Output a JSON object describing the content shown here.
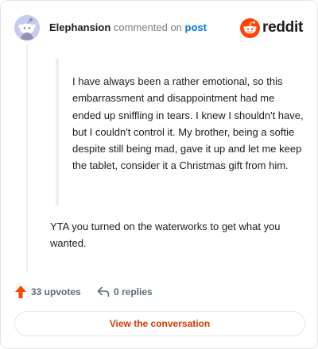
{
  "header": {
    "username": "Elephansion",
    "action_text": "commented on",
    "post_link": "post",
    "brand": "reddit"
  },
  "comment": {
    "quote": "I have always been a rather emotional, so this embarrassment and disappointment had me ended up sniffling in tears. I knew I shouldn't have, but I couldn't control it. My brother, being a softie despite still being mad, gave it up and let me keep the tablet, consider it a Christmas gift from him.",
    "reply": "YTA you turned on the waterworks to get what you wanted."
  },
  "footer": {
    "upvotes": "33 upvotes",
    "replies": "0 replies",
    "cta": "View the conversation"
  },
  "colors": {
    "brand": "#ff4500",
    "cta_text": "#d93a00",
    "link": "#0079d3",
    "muted": "#576f76"
  },
  "icons": {
    "avatar": "snoo-avatar-icon",
    "logo": "reddit-snoo-icon",
    "upvote": "upvote-arrow-icon",
    "reply": "reply-arrow-icon"
  }
}
